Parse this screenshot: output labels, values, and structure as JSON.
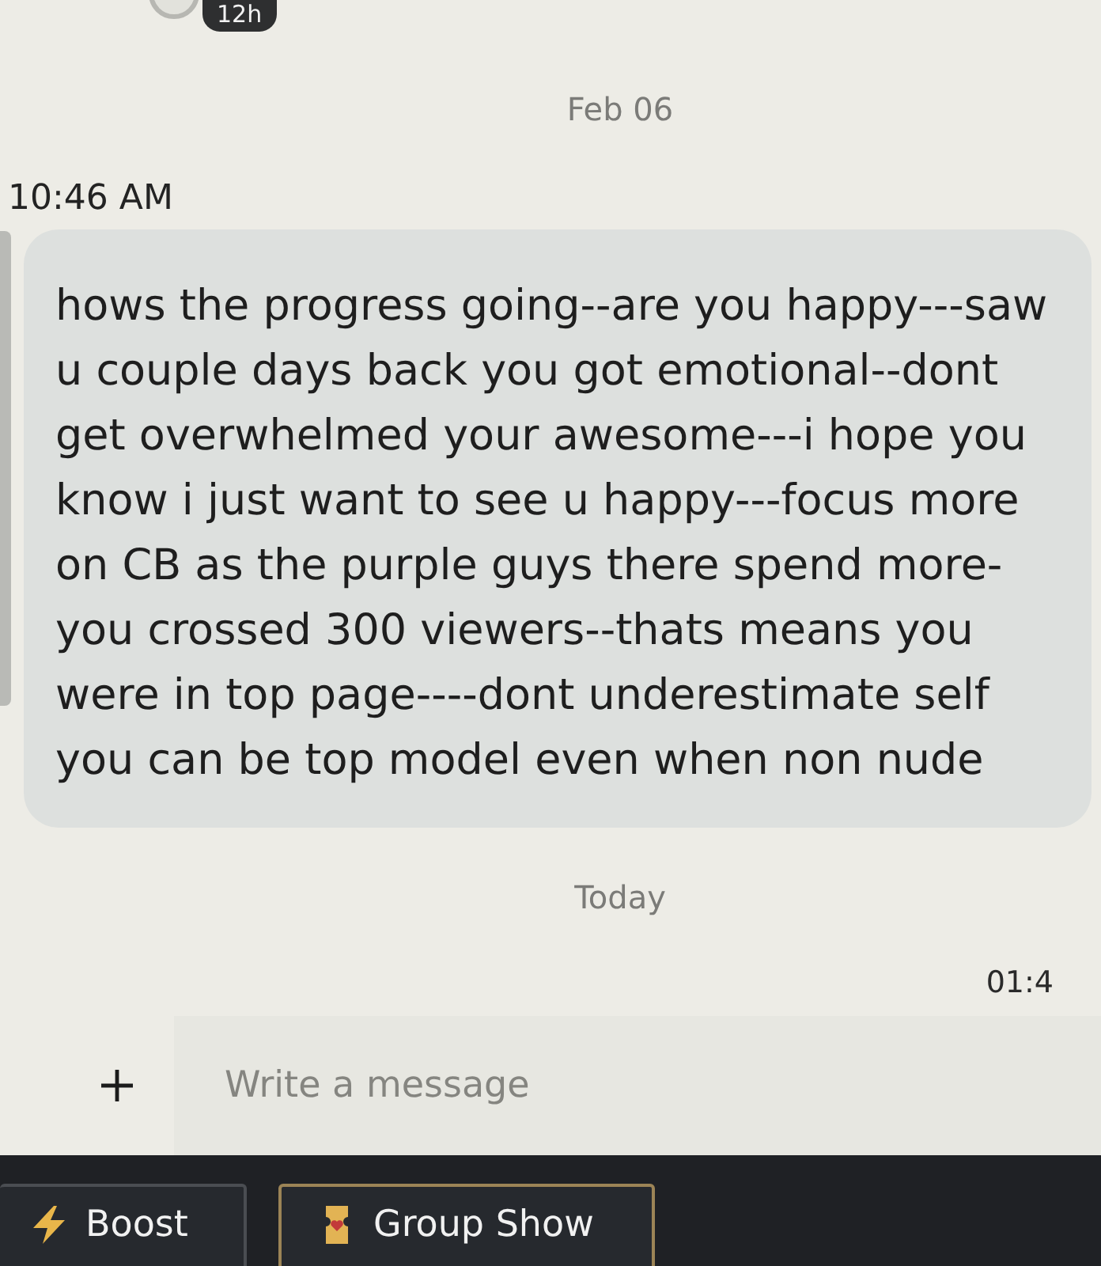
{
  "top": {
    "status_badge": "12h"
  },
  "conversation": [
    {
      "kind": "date",
      "text": "Feb 06"
    },
    {
      "kind": "time_left",
      "text": "10:46 AM"
    },
    {
      "kind": "bubble",
      "text": "hows the progress going--are you happy---saw u couple days back you got emotional--dont get overwhelmed your awesome---i hope you know i just want to see u happy---focus more on CB as the purple guys there spend more-you crossed 300 viewers--thats means you were in top page----dont underestimate self you can be top model even when non nude"
    },
    {
      "kind": "date",
      "text": "Today"
    },
    {
      "kind": "time_right",
      "text": "01:4"
    }
  ],
  "composer": {
    "placeholder": "Write a message"
  },
  "actions": [
    {
      "kind": "boost",
      "label": "Boost"
    },
    {
      "kind": "group_show",
      "label": "Group Show"
    }
  ]
}
